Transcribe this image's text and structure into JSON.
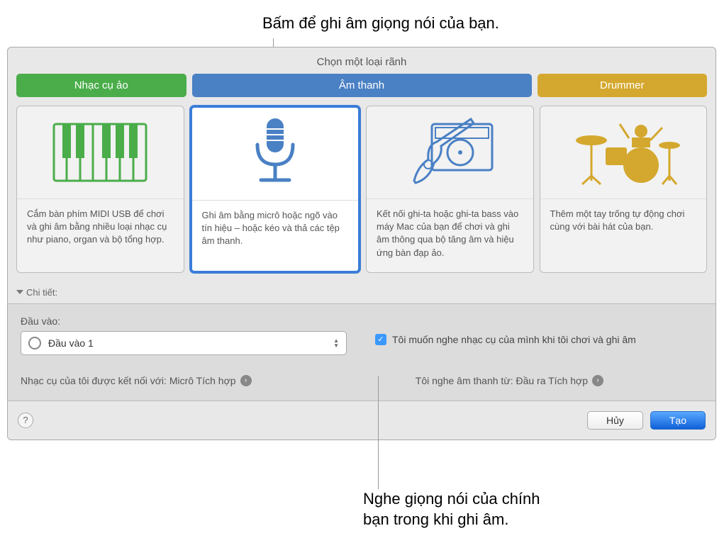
{
  "callouts": {
    "top": "Bấm để ghi âm giọng nói của bạn.",
    "bottom": "Nghe giọng nói của chính\nbạn trong khi ghi âm."
  },
  "window": {
    "title": "Chọn một loại rãnh",
    "tabs": {
      "virtual": "Nhạc cụ ảo",
      "audio": "Âm thanh",
      "drummer": "Drummer"
    },
    "cards": {
      "keyboard": {
        "icon": "keyboard-icon",
        "desc": "Cắm bàn phím MIDI USB để chơi và ghi âm bằng nhiều loại nhạc cụ như piano, organ và bộ tổng hợp."
      },
      "mic": {
        "icon": "microphone-icon",
        "desc": "Ghi âm bằng micrô hoặc ngõ vào tín hiệu – hoặc kéo và thả các tệp âm thanh."
      },
      "guitar": {
        "icon": "guitar-amp-icon",
        "desc": "Kết nối ghi-ta hoặc ghi-ta bass vào máy Mac của bạn để chơi và ghi âm thông qua bộ tăng âm và hiệu ứng bàn đạp ảo."
      },
      "drums": {
        "icon": "drumkit-icon",
        "desc": "Thêm một tay trống tự động chơi cùng với bài hát của bạn."
      }
    },
    "details_label": "Chi tiết:",
    "input": {
      "label": "Đầu vào:",
      "value": "Đầu vào 1"
    },
    "monitor_checkbox": "Tôi muốn nghe nhạc cụ của mình khi tôi chơi và ghi âm",
    "links": {
      "connected": "Nhạc cụ của tôi được kết nối với: Micrô Tích hợp",
      "output": "Tôi nghe âm thanh từ: Đầu ra Tích hợp"
    },
    "footer": {
      "help": "?",
      "cancel": "Hủy",
      "create": "Tạo"
    }
  }
}
